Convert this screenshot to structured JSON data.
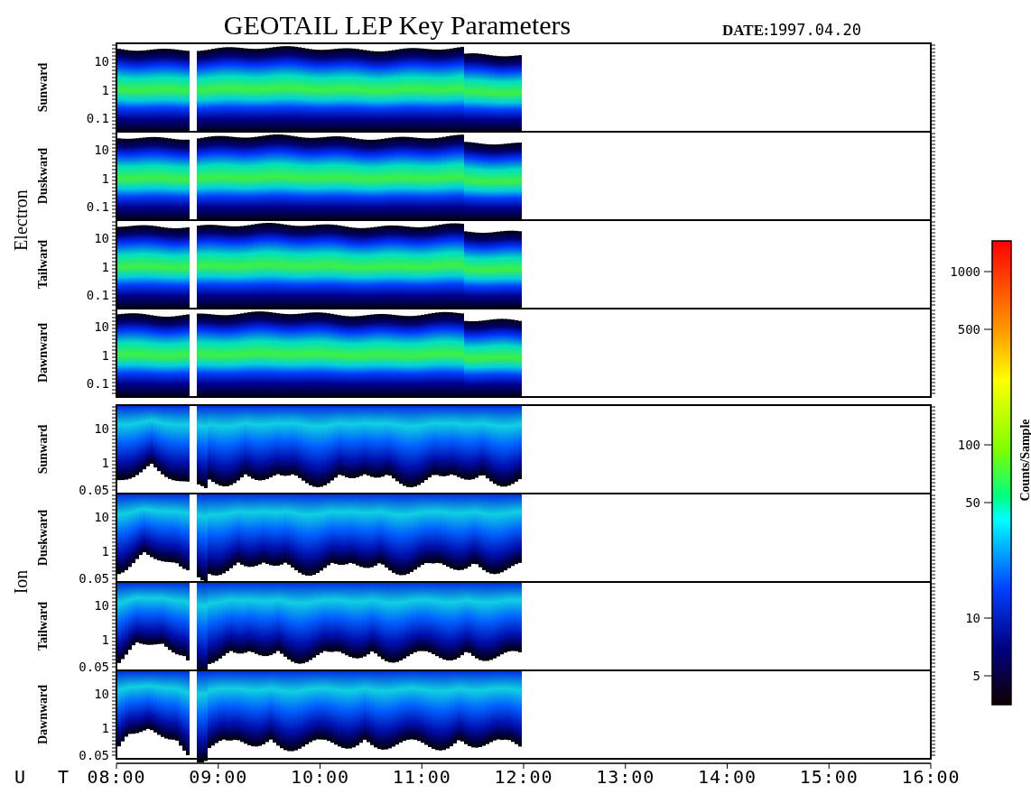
{
  "title": "GEOTAIL LEP Key Parameters",
  "date": {
    "label": "DATE:",
    "value": "1997.04.20"
  },
  "groups": [
    {
      "kind": "electron",
      "label": "Electron",
      "panels": [
        {
          "label": "Sunward",
          "yticks": [
            "10",
            "1",
            "0.1"
          ]
        },
        {
          "label": "Duskward",
          "yticks": [
            "10",
            "1",
            "0.1"
          ]
        },
        {
          "label": "Tailward",
          "yticks": [
            "10",
            "1",
            "0.1"
          ]
        },
        {
          "label": "Dawnward",
          "yticks": [
            "10",
            "1",
            "0.1"
          ]
        }
      ]
    },
    {
      "kind": "ion",
      "label": "Ion",
      "panels": [
        {
          "label": "Sunward",
          "yticks": [
            "10",
            "1",
            "0.05"
          ]
        },
        {
          "label": "Duskward",
          "yticks": [
            "10",
            "1",
            "0.05"
          ]
        },
        {
          "label": "Tailward",
          "yticks": [
            "10",
            "1",
            "0.05"
          ]
        },
        {
          "label": "Dawnward",
          "yticks": [
            "10",
            "1",
            "0.05"
          ]
        }
      ]
    }
  ],
  "time_axis": {
    "label": "U T",
    "ticks": [
      "08:00",
      "09:00",
      "10:00",
      "11:00",
      "12:00",
      "13:00",
      "14:00",
      "15:00",
      "16:00"
    ]
  },
  "colorbar": {
    "label": "Counts/Sample",
    "ticks": [
      "1000",
      "500",
      "100",
      "50",
      "10",
      "5"
    ]
  }
}
